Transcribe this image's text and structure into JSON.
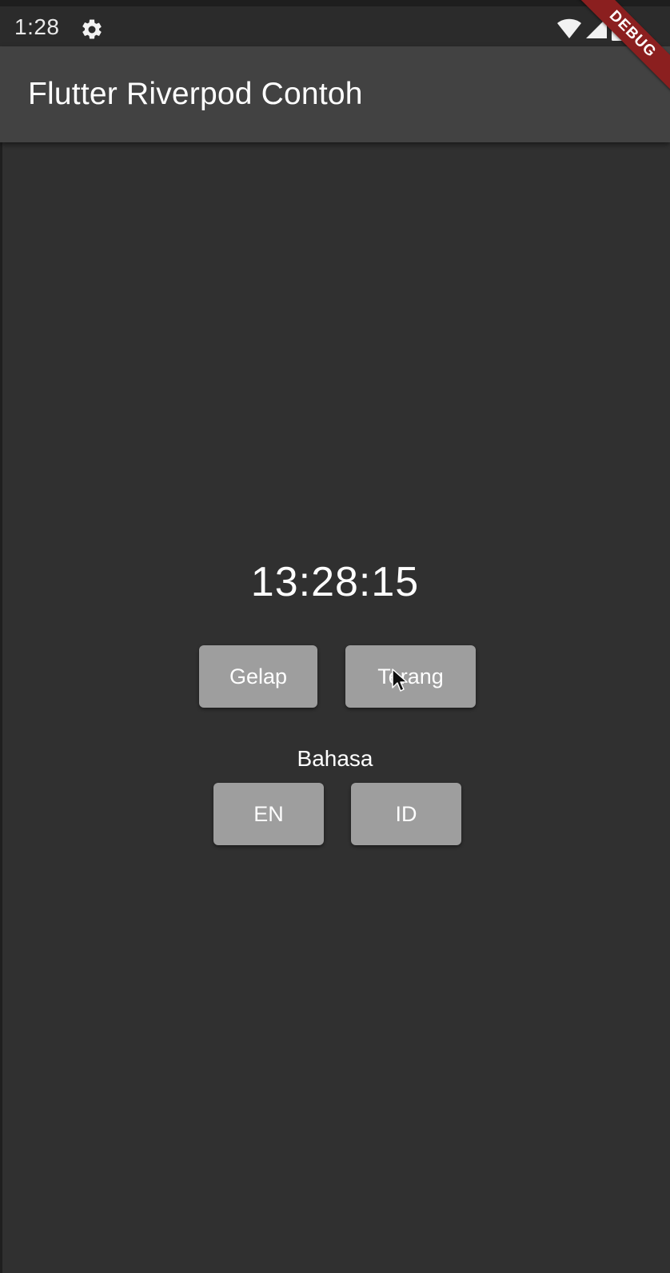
{
  "status_bar": {
    "time": "1:28",
    "icons": [
      "gear-icon",
      "wifi-icon",
      "signal-icon",
      "battery-icon"
    ]
  },
  "app_bar": {
    "title": "Flutter Riverpod Contoh"
  },
  "debug_banner": {
    "label": "DEBUG",
    "color": "#8b1f1f"
  },
  "main": {
    "clock": "13:28:15",
    "theme_buttons": {
      "dark_label": "Gelap",
      "light_label": "Terang"
    },
    "language": {
      "label": "Bahasa",
      "en_label": "EN",
      "id_label": "ID"
    }
  },
  "colors": {
    "background": "#303030",
    "app_bar": "#424242",
    "button": "#9e9e9e"
  }
}
